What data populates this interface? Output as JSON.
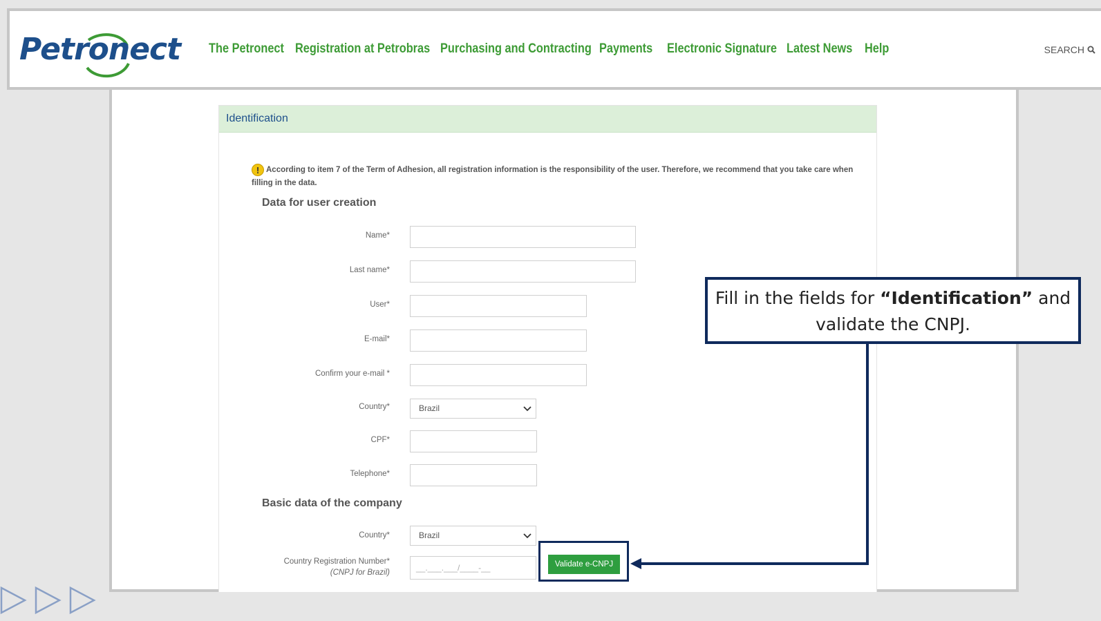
{
  "header": {
    "logo_text": "Petronect",
    "nav": [
      {
        "label": "The Petronect"
      },
      {
        "label": "Registration at Petrobras"
      },
      {
        "label": "Purchasing and Contracting"
      },
      {
        "label": "Payments"
      },
      {
        "label": "Electronic Signature"
      },
      {
        "label": "Latest News"
      },
      {
        "label": "Help"
      }
    ],
    "search_label": "SEARCH"
  },
  "form": {
    "header_title": "Identification",
    "notice": "According to item 7 of the Term of Adhesion, all registration information is the responsibility of the user. Therefore, we recommend that you take care when filling in the data.",
    "user_section_title": "Data for user creation",
    "fields": {
      "name": "Name*",
      "last_name": "Last name*",
      "user": "User*",
      "email": "E-mail*",
      "confirm_email": "Confirm your e-mail *",
      "country": "Country*",
      "country_value": "Brazil",
      "cpf": "CPF*",
      "telephone": "Telephone*"
    },
    "company_section_title": "Basic data of the company",
    "company_fields": {
      "country": "Country*",
      "country_value": "Brazil",
      "reg_number": "Country Registration Number*",
      "reg_number_sub": "(CNPJ for Brazil)",
      "reg_number_placeholder": "__.___.___/____-__"
    },
    "validate_button": "Validate e-CNPJ"
  },
  "callout": {
    "text_before": "Fill in the fields for ",
    "text_bold": "“Identification”",
    "text_after": " and validate the CNPJ."
  },
  "colors": {
    "nav_green": "#3d9b35",
    "brand_blue": "#1d4f8b",
    "button_green": "#2e9e3f",
    "callout_border": "#0f2a5c",
    "section_header_bg": "#dcefd9"
  }
}
